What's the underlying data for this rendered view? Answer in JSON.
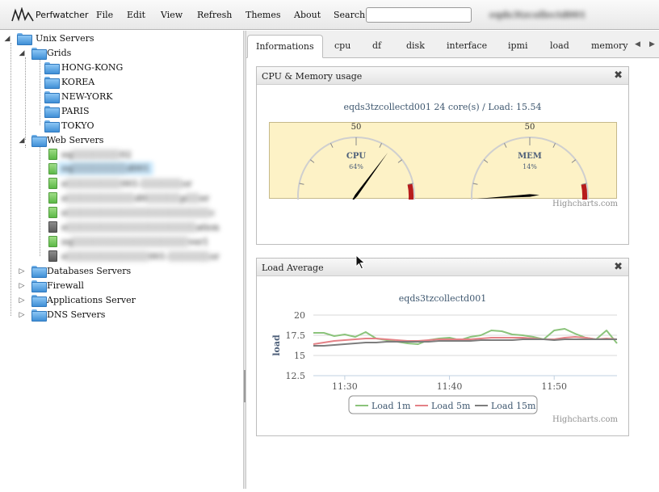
{
  "app": {
    "name": "Perfwatcher",
    "host": "eqds3tzcollectd001"
  },
  "menu": {
    "items": [
      "File",
      "Edit",
      "View",
      "Refresh",
      "Themes",
      "About"
    ],
    "search_label": "Search",
    "search_value": ""
  },
  "tree": {
    "unix": "Unix Servers",
    "grids": "Grids",
    "grid_items": [
      "HONG-KONG",
      "KOREA",
      "NEW-YORK",
      "PARIS",
      "TOKYO"
    ],
    "web": "Web Servers",
    "web_items": [
      "eq░░░░░░░02",
      "eq░░░░░░░░d001",
      "e░░░░░░░░001-░░░░░░or",
      "e░░░░░░░░░░d0░░░░░p░░er",
      "e░░░░░░░░░░░░░░░░░░░░░c",
      "e░░░░░░░░░░░░░░░░░░░ation",
      "eq░░░░░░░░░░░░░░░░░ver1",
      "e░░░░░░░░░░░░001-░░░░░░or"
    ],
    "others": [
      "Databases Servers",
      "Firewall",
      "Applications Server",
      "DNS Servers"
    ]
  },
  "tabs": [
    "Informations",
    "cpu",
    "df",
    "disk",
    "interface",
    "ipmi",
    "load",
    "memory"
  ],
  "cpu_panel": {
    "title": "CPU & Memory usage",
    "subtitle": "eqds3tzcollectd001 24 core(s) / Load: 15.54",
    "credits": "Highcharts.com"
  },
  "load_panel": {
    "title": "Load Average",
    "credits": "Highcharts.com"
  },
  "chart_data": [
    {
      "type": "gauge",
      "subtitle": "eqds3tzcollectd001 24 core(s) / Load: 15.54",
      "gauges": [
        {
          "label": "CPU",
          "value": 64,
          "value_text": "64%",
          "min": 0,
          "max": 100,
          "ticks": [
            "0",
            "50",
            "100"
          ]
        },
        {
          "label": "MEM",
          "value": 14,
          "value_text": "14%",
          "min": 0,
          "max": 100,
          "ticks": [
            "0",
            "50",
            "100"
          ]
        }
      ]
    },
    {
      "type": "line",
      "title": "eqds3tzcollectd001",
      "ylabel": "load",
      "ylim": [
        12.5,
        20
      ],
      "yticks": [
        "20",
        "17.5",
        "15",
        "12.5"
      ],
      "xticks": [
        "11:30",
        "11:40",
        "11:50"
      ],
      "grid": true,
      "legend": "bottom",
      "x": [
        "11:27",
        "11:28",
        "11:29",
        "11:30",
        "11:31",
        "11:32",
        "11:33",
        "11:34",
        "11:35",
        "11:36",
        "11:37",
        "11:38",
        "11:39",
        "11:40",
        "11:41",
        "11:42",
        "11:43",
        "11:44",
        "11:45",
        "11:46",
        "11:47",
        "11:48",
        "11:49",
        "11:50",
        "11:51",
        "11:52",
        "11:53",
        "11:54",
        "11:55",
        "11:56"
      ],
      "series": [
        {
          "name": "Load 1m",
          "color": "#8bc37b",
          "values": [
            17.8,
            17.8,
            17.4,
            17.6,
            17.3,
            17.9,
            17.1,
            16.9,
            16.7,
            16.5,
            16.4,
            16.9,
            17.1,
            17.2,
            16.9,
            17.3,
            17.5,
            18.1,
            18.0,
            17.6,
            17.5,
            17.3,
            17.0,
            18.1,
            18.3,
            17.7,
            17.2,
            17.0,
            18.1,
            16.5
          ]
        },
        {
          "name": "Load 5m",
          "color": "#e48186",
          "values": [
            16.4,
            16.6,
            16.8,
            16.9,
            17.0,
            17.1,
            17.1,
            17.0,
            16.9,
            16.8,
            16.8,
            16.9,
            17.0,
            17.0,
            17.0,
            17.0,
            17.1,
            17.2,
            17.2,
            17.2,
            17.2,
            17.1,
            17.0,
            17.0,
            17.2,
            17.3,
            17.2,
            17.0,
            17.1,
            17.0
          ]
        },
        {
          "name": "Load 15m",
          "color": "#7d7d7d",
          "values": [
            16.2,
            16.2,
            16.3,
            16.4,
            16.5,
            16.6,
            16.6,
            16.7,
            16.7,
            16.7,
            16.7,
            16.7,
            16.8,
            16.8,
            16.8,
            16.8,
            16.9,
            16.9,
            16.9,
            16.9,
            17.0,
            17.0,
            17.0,
            16.9,
            17.0,
            17.0,
            17.0,
            17.0,
            17.0,
            17.0
          ]
        }
      ]
    }
  ]
}
